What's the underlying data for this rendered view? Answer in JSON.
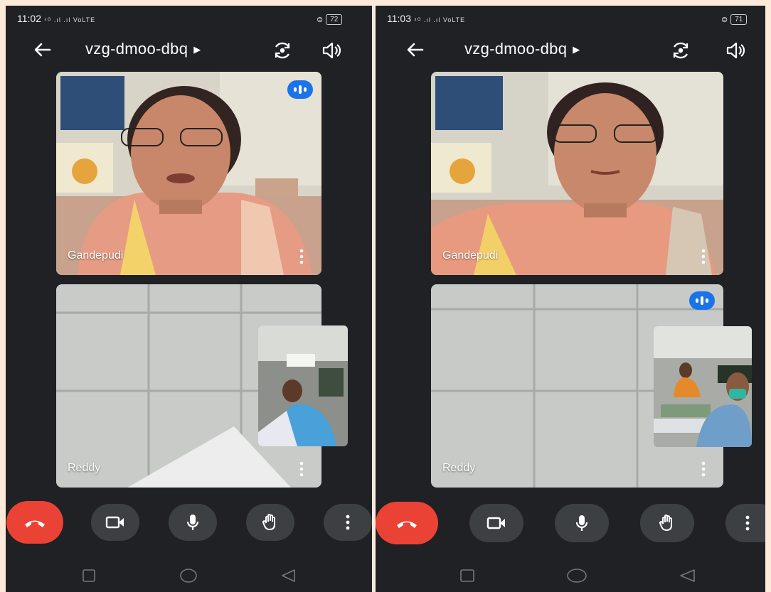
{
  "left": {
    "status_time": "11:02",
    "status_signal": "⁴ᴳ .ıl .ıl VoLTE",
    "battery": "72",
    "meeting_code": "vzg-dmoo-dbq",
    "participants": [
      {
        "name": "Gandepudi"
      },
      {
        "name": "Reddy"
      }
    ]
  },
  "right": {
    "status_time": "11:03",
    "status_signal": "⁴ᴳ .ıl .ıl VoLTE",
    "battery": "71",
    "meeting_code": "vzg-dmoo-dbq",
    "participants": [
      {
        "name": "Gandepudi"
      },
      {
        "name": "Reddy"
      }
    ]
  },
  "icons": {
    "back": "arrow-left-icon",
    "caret": "caret-right-icon",
    "switch_camera": "switch-camera-icon",
    "speaker": "speaker-icon",
    "more": "more-vertical-icon",
    "end_call": "phone-hangup-icon",
    "camera": "video-camera-icon",
    "mic": "microphone-icon",
    "raise_hand": "hand-icon",
    "nav_recent": "square-icon",
    "nav_home": "circle-icon",
    "nav_back": "triangle-back-icon"
  },
  "colors": {
    "background": "#1f2124",
    "end_call": "#ea4335",
    "control": "#3c4043",
    "speaking": "#1a73e8",
    "frame": "#fde9d9"
  }
}
